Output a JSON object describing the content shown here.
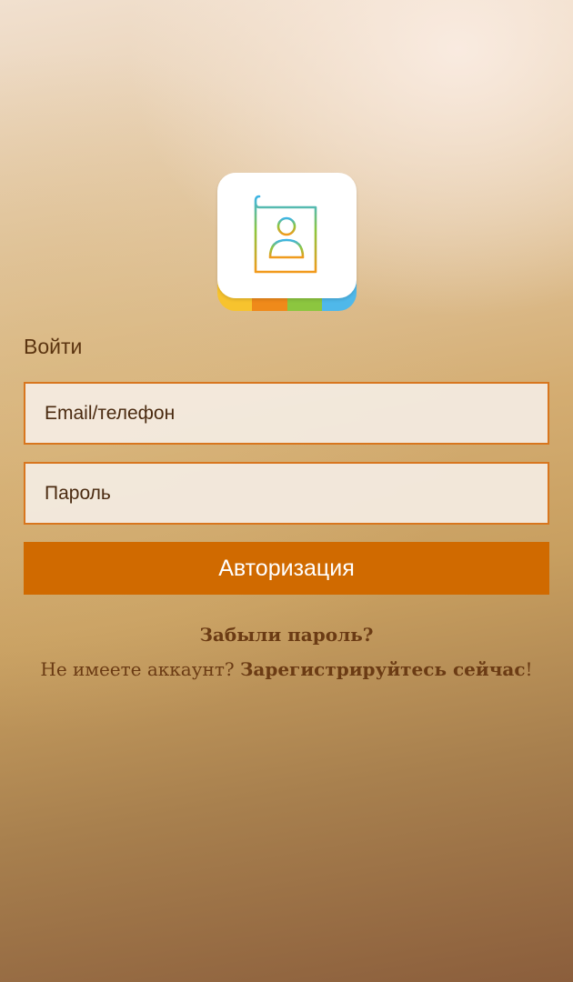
{
  "app": {
    "icon_name": "address-book-icon",
    "icon_stripe_colors": [
      "#f7c32e",
      "#ef8a1a",
      "#8cc63f",
      "#4fb8ea"
    ]
  },
  "login": {
    "title": "Войти",
    "email_placeholder": "Email/телефон",
    "password_placeholder": "Пароль",
    "submit_label": "Авторизация"
  },
  "links": {
    "forgot_password": "Забыли пароль?",
    "no_account_text": "Не имеете аккаунт?",
    "register_now": "Зарегистрируйтесь сейчас",
    "register_suffix": "!"
  },
  "colors": {
    "accent": "#d06a00",
    "field_border": "#d8761e",
    "text_brown": "#6b3b14"
  }
}
